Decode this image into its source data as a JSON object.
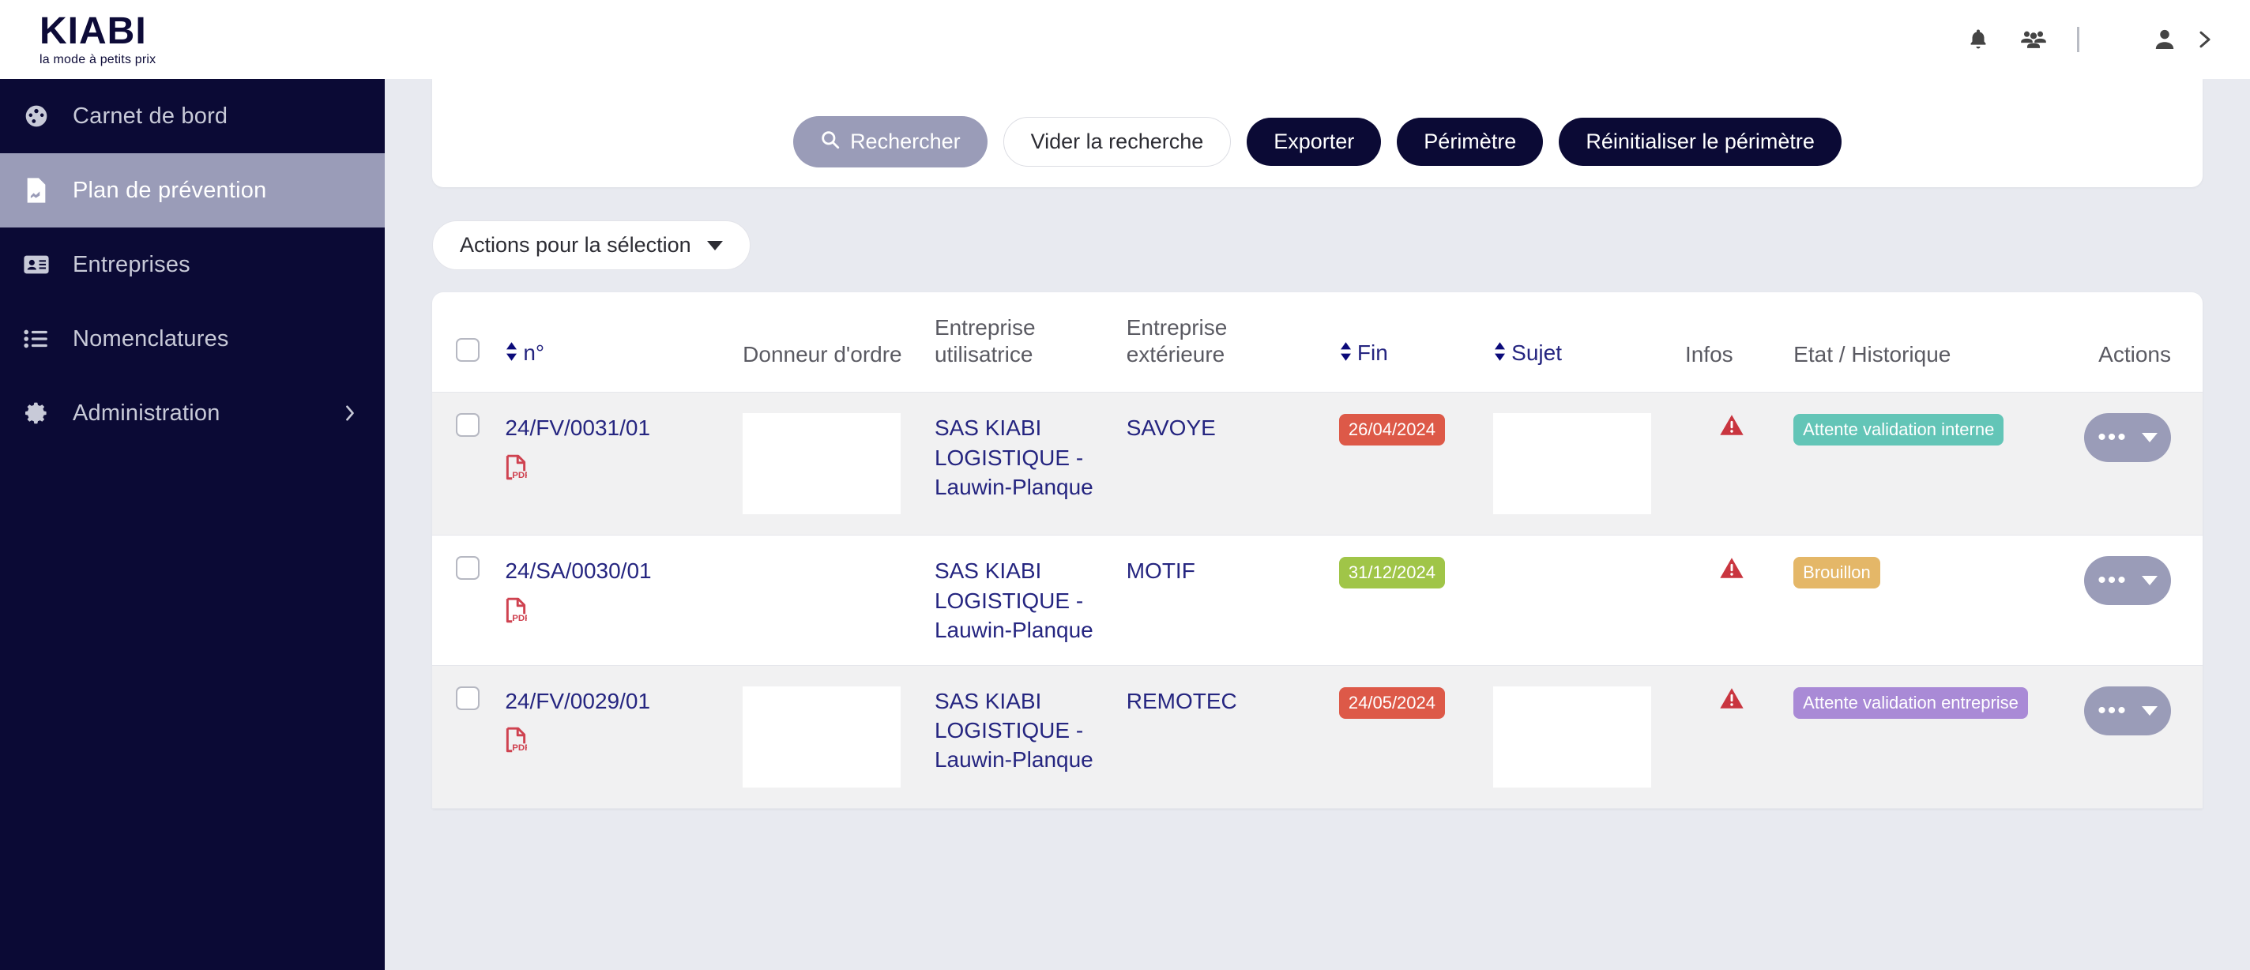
{
  "brand": {
    "name": "KIABI",
    "tagline": "la mode à petits prix"
  },
  "header": {
    "icons": [
      {
        "name": "notifications-bell-icon"
      },
      {
        "name": "users-group-icon"
      },
      {
        "name": "divider"
      },
      {
        "name": "user-profile-icon"
      },
      {
        "name": "chevron-right-icon"
      }
    ]
  },
  "sidebar": {
    "items": [
      {
        "label": "Carnet de bord",
        "icon": "dashboard-icon",
        "active": false,
        "has_submenu": false
      },
      {
        "label": "Plan de prévention",
        "icon": "document-chart-icon",
        "active": true,
        "has_submenu": false
      },
      {
        "label": "Entreprises",
        "icon": "id-card-icon",
        "active": false,
        "has_submenu": false
      },
      {
        "label": "Nomenclatures",
        "icon": "list-icon",
        "active": false,
        "has_submenu": false
      },
      {
        "label": "Administration",
        "icon": "gear-icon",
        "active": false,
        "has_submenu": true
      }
    ]
  },
  "toolbar": {
    "search_label": "Rechercher",
    "clear_label": "Vider la recherche",
    "export_label": "Exporter",
    "perimeter_label": "Périmètre",
    "reset_perimeter_label": "Réinitialiser le périmètre"
  },
  "actions_bar": {
    "selection_actions_label": "Actions pour la sélection"
  },
  "table": {
    "columns": [
      {
        "key": "checkbox",
        "label": "",
        "sortable": false
      },
      {
        "key": "num",
        "label": "n°",
        "sortable": true
      },
      {
        "key": "donneur",
        "label": "Donneur d'ordre",
        "sortable": false
      },
      {
        "key": "eu",
        "label": "Entreprise utilisatrice",
        "sortable": false
      },
      {
        "key": "ee",
        "label": "Entreprise extérieure",
        "sortable": false
      },
      {
        "key": "fin",
        "label": "Fin",
        "sortable": true
      },
      {
        "key": "sujet",
        "label": "Sujet",
        "sortable": true
      },
      {
        "key": "infos",
        "label": "Infos",
        "sortable": false
      },
      {
        "key": "etat",
        "label": "Etat / Historique",
        "sortable": false
      },
      {
        "key": "actions",
        "label": "Actions",
        "sortable": false
      }
    ],
    "rows": [
      {
        "num": "24/FV/0031/01",
        "has_pdf": true,
        "donneur": "",
        "donneur_blank": true,
        "entreprise_utilisatrice": "SAS KIABI LOGISTIQUE - Lauwin-Planque",
        "entreprise_exterieure": "SAVOYE",
        "fin": "26/04/2024",
        "fin_color": "red",
        "sujet": "",
        "sujet_blank": true,
        "has_warning": true,
        "etat": "Attente validation interne",
        "etat_color": "teal"
      },
      {
        "num": "24/SA/0030/01",
        "has_pdf": true,
        "donneur": "",
        "donneur_blank": false,
        "entreprise_utilisatrice": "SAS KIABI LOGISTIQUE - Lauwin-Planque",
        "entreprise_exterieure": "MOTIF",
        "fin": "31/12/2024",
        "fin_color": "green",
        "sujet": "",
        "sujet_blank": false,
        "has_warning": true,
        "etat": "Brouillon",
        "etat_color": "amber"
      },
      {
        "num": "24/FV/0029/01",
        "has_pdf": true,
        "donneur": "",
        "donneur_blank": true,
        "entreprise_utilisatrice": "SAS KIABI LOGISTIQUE - Lauwin-Planque",
        "entreprise_exterieure": "REMOTEC",
        "fin": "24/05/2024",
        "fin_color": "red",
        "sujet": "",
        "sujet_blank": true,
        "has_warning": true,
        "etat": "Attente validation entreprise",
        "etat_color": "purple"
      }
    ]
  },
  "colors": {
    "brand_navy": "#0b0a35",
    "accent_muted": "#9a9cb8",
    "page_bg": "#e8eaf0",
    "link_navy": "#252580",
    "badge_red": "#dd5948",
    "badge_green": "#a0c548",
    "badge_teal": "#63c5b7",
    "badge_amber": "#e4b768",
    "badge_purple": "#a98ad6",
    "pdf_red": "#cf4250"
  }
}
